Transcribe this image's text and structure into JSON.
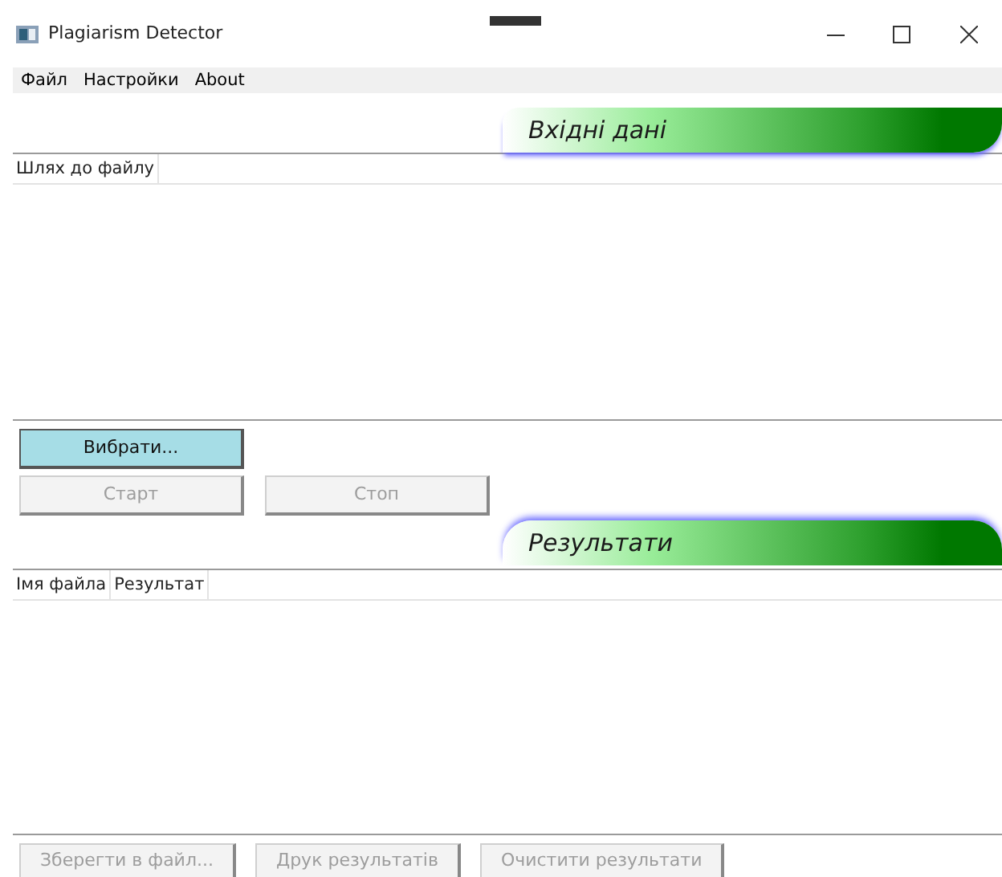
{
  "window": {
    "title": "Plagiarism Detector"
  },
  "menu": [
    "Файл",
    "Настройки",
    "About"
  ],
  "input_section": {
    "banner": "Вхідні дані",
    "columns": [
      "Шлях до файлу"
    ],
    "buttons": [
      {
        "label": "Вибрати...",
        "disabled": false,
        "highlighted": true
      },
      {
        "label": "Старт",
        "disabled": true,
        "highlighted": false
      },
      {
        "label": "Стоп",
        "disabled": true,
        "highlighted": false
      }
    ]
  },
  "results_section": {
    "banner": "Результати",
    "columns": [
      "Імя файла",
      "Результат"
    ],
    "buttons": [
      {
        "label": "Зберегти в файл...",
        "disabled": true
      },
      {
        "label": "Друк результатів",
        "disabled": true
      },
      {
        "label": "Очистити результати",
        "disabled": true
      }
    ]
  }
}
